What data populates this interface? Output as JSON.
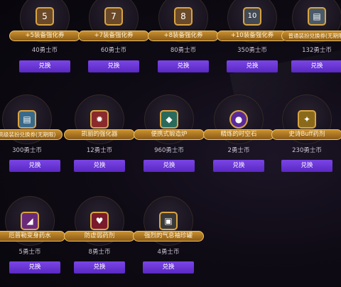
{
  "items": [
    {
      "name": "+5装备强化券",
      "price": "40勇士币",
      "icon": "ticket-icon",
      "glyph": "5",
      "color": "#6b4a2a",
      "button": "兑换"
    },
    {
      "name": "+7装备强化券",
      "price": "60勇士币",
      "icon": "ticket-icon",
      "glyph": "7",
      "color": "#6b4a2a",
      "button": "兑换"
    },
    {
      "name": "+8装备强化券",
      "price": "80勇士币",
      "icon": "ticket-icon",
      "glyph": "8",
      "color": "#6b4a2a",
      "button": "兑换"
    },
    {
      "name": "+10装备强化券",
      "price": "350勇士币",
      "icon": "ticket-icon",
      "glyph": "10",
      "color": "#444a55",
      "button": "兑换"
    },
    {
      "name": "普通装扮兑换券(无期限)",
      "price": "132勇士币",
      "icon": "outfit-ticket-icon",
      "glyph": "▤",
      "color": "#4a5a6a",
      "button": "兑换"
    },
    {
      "name": "高级装扮兑换券(无期限)",
      "price": "300勇士币",
      "icon": "outfit-ticket-icon",
      "glyph": "▤",
      "color": "#3a6a8a",
      "button": "兑换"
    },
    {
      "name": "凯丽的强化器",
      "price": "12勇士币",
      "icon": "enhancer-icon",
      "glyph": "✹",
      "color": "#8a2a2a",
      "button": "兑换"
    },
    {
      "name": "便携式锻造炉",
      "price": "960勇士币",
      "icon": "forge-icon",
      "glyph": "◆",
      "color": "#2a6a5a",
      "button": "兑换"
    },
    {
      "name": "精炼的时空石",
      "price": "2勇士币",
      "icon": "spacetime-stone-icon",
      "glyph": "●",
      "color": "#5a2a9a",
      "button": "兑换"
    },
    {
      "name": "史诗Buff药剂",
      "price": "230勇士币",
      "icon": "buff-potion-icon",
      "glyph": "✦",
      "color": "#8a6a1a",
      "button": "兑换"
    },
    {
      "name": "厄普勒变身药水",
      "price": "5勇士币",
      "icon": "transform-potion-icon",
      "glyph": "◢",
      "color": "#6a2a7a",
      "button": "兑换"
    },
    {
      "name": "防虚弱药剂",
      "price": "8勇士币",
      "icon": "potion-icon",
      "glyph": "♥",
      "color": "#7a1a2a",
      "button": "兑换"
    },
    {
      "name": "强烈的气息袖珍罐",
      "price": "4勇士币",
      "icon": "jar-icon",
      "glyph": "▣",
      "color": "#3a3a3a",
      "button": "兑换"
    }
  ]
}
